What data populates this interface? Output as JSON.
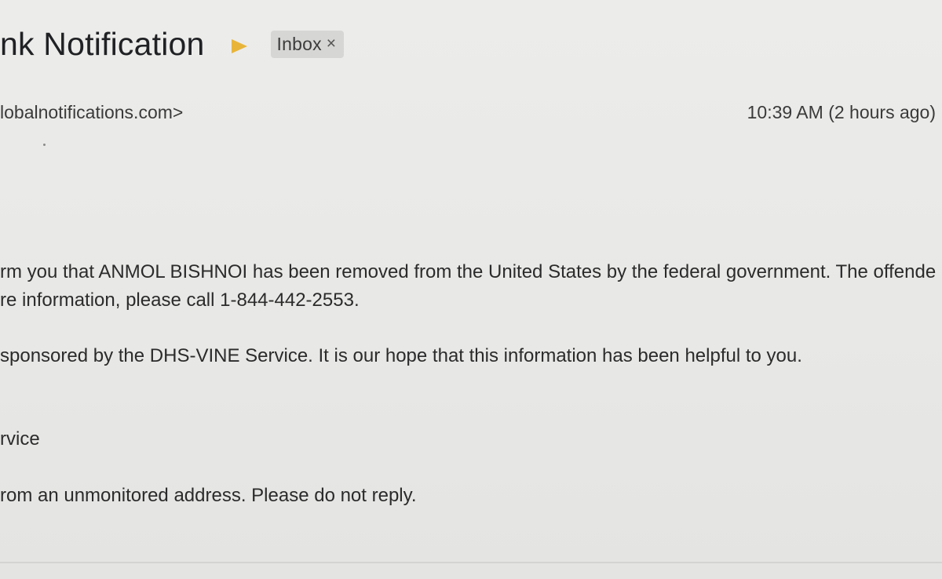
{
  "header": {
    "subject": "nk Notification",
    "label": "Inbox",
    "label_close": "×",
    "importance_color": "#e8b53a"
  },
  "meta": {
    "sender": "lobalnotifications.com>",
    "timestamp": "10:39 AM (2 hours ago)"
  },
  "body": {
    "line1": "rm you that ANMOL BISHNOI has been removed from the United States by the federal government. The offende",
    "line2": "re information, please call 1-844-442-2553.",
    "line3": "sponsored by the DHS-VINE Service. It is our hope that this information has been helpful to you.",
    "line4": "rvice",
    "line5": "rom an unmonitored address. Please do not reply."
  }
}
